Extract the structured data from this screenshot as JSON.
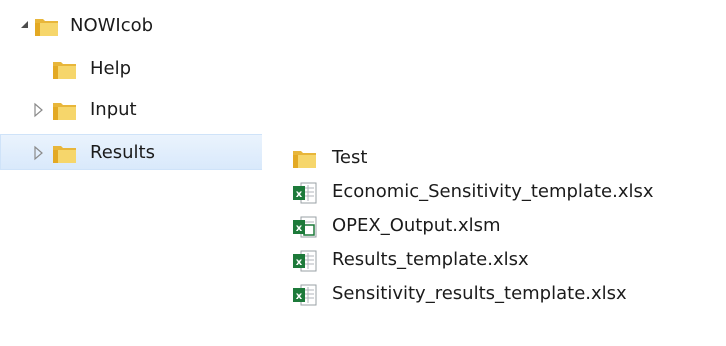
{
  "tree": {
    "root": {
      "label": "NOWIcob",
      "expanded": true,
      "icon": "folder-icon"
    },
    "children": [
      {
        "label": "Help",
        "has_children": false,
        "selected": false
      },
      {
        "label": "Input",
        "has_children": true,
        "selected": false
      },
      {
        "label": "Results",
        "has_children": true,
        "selected": true
      }
    ]
  },
  "files": [
    {
      "name": "Test",
      "type": "folder",
      "icon": "folder-icon"
    },
    {
      "name": "Economic_Sensitivity_template.xlsx",
      "type": "xlsx",
      "icon": "excel-file-icon"
    },
    {
      "name": "OPEX_Output.xlsm",
      "type": "xlsm",
      "icon": "excel-macro-file-icon"
    },
    {
      "name": "Results_template.xlsx",
      "type": "xlsx",
      "icon": "excel-file-icon"
    },
    {
      "name": "Sensitivity_results_template.xlsx",
      "type": "xlsx",
      "icon": "excel-file-icon"
    }
  ],
  "colors": {
    "selection_bg": "#d9e9fb",
    "selection_border": "#cfe3f9",
    "folder_yellow": "#f2c94c",
    "excel_green": "#1d7a3a"
  }
}
